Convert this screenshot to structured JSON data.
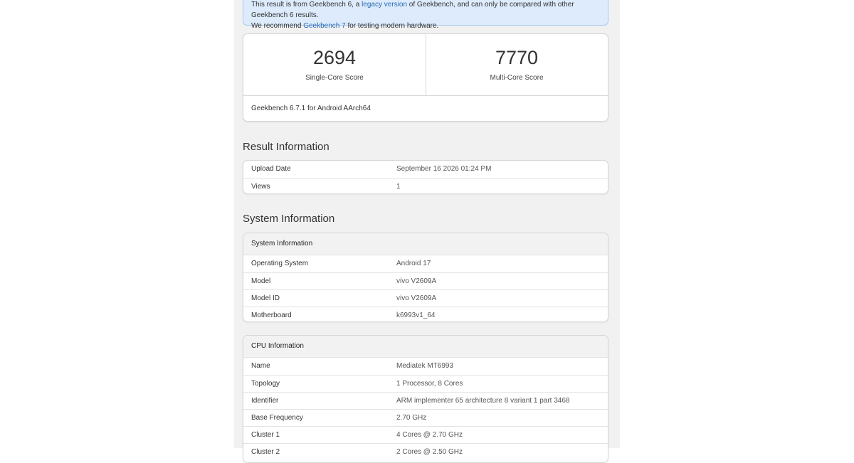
{
  "notice": {
    "line1_a": "This result is from Geekbench 6, a ",
    "link1": "legacy version",
    "line1_b": " of Geekbench, and can only be compared with other Geekbench 6 results.",
    "line2_a": "We recommend ",
    "link2": "Geekbench 7",
    "line2_b": " for testing modern hardware."
  },
  "scores": {
    "single_value": "2694",
    "single_label": "Single-Core Score",
    "multi_value": "7770",
    "multi_label": "Multi-Core Score",
    "footer": "Geekbench 6.7.1 for Android AArch64"
  },
  "result_info": {
    "title": "Result Information",
    "rows": [
      {
        "key": "Upload Date",
        "value": "September 16 2026 01:24 PM"
      },
      {
        "key": "Views",
        "value": "1"
      }
    ]
  },
  "system_info": {
    "section_title": "System Information",
    "card_title": "System Information",
    "rows": [
      {
        "key": "Operating System",
        "value": "Android 17"
      },
      {
        "key": "Model",
        "value": "vivo V2609A"
      },
      {
        "key": "Model ID",
        "value": "vivo V2609A"
      },
      {
        "key": "Motherboard",
        "value": "k6993v1_64"
      }
    ]
  },
  "cpu_info": {
    "card_title": "CPU Information",
    "rows": [
      {
        "key": "Name",
        "value": "Mediatek MT6993"
      },
      {
        "key": "Topology",
        "value": "1 Processor, 8 Cores"
      },
      {
        "key": "Identifier",
        "value": "ARM implementer 65 architecture 8 variant 1 part 3468"
      },
      {
        "key": "Base Frequency",
        "value": "2.70 GHz"
      },
      {
        "key": "Cluster 1",
        "value": "4 Cores @ 2.70 GHz"
      },
      {
        "key": "Cluster 2",
        "value": "2 Cores @ 2.50 GHz"
      }
    ]
  },
  "colors": {
    "notice_bg": "#ddebfc",
    "link": "#2a6bb5",
    "page_column": "#f1f1f1"
  }
}
